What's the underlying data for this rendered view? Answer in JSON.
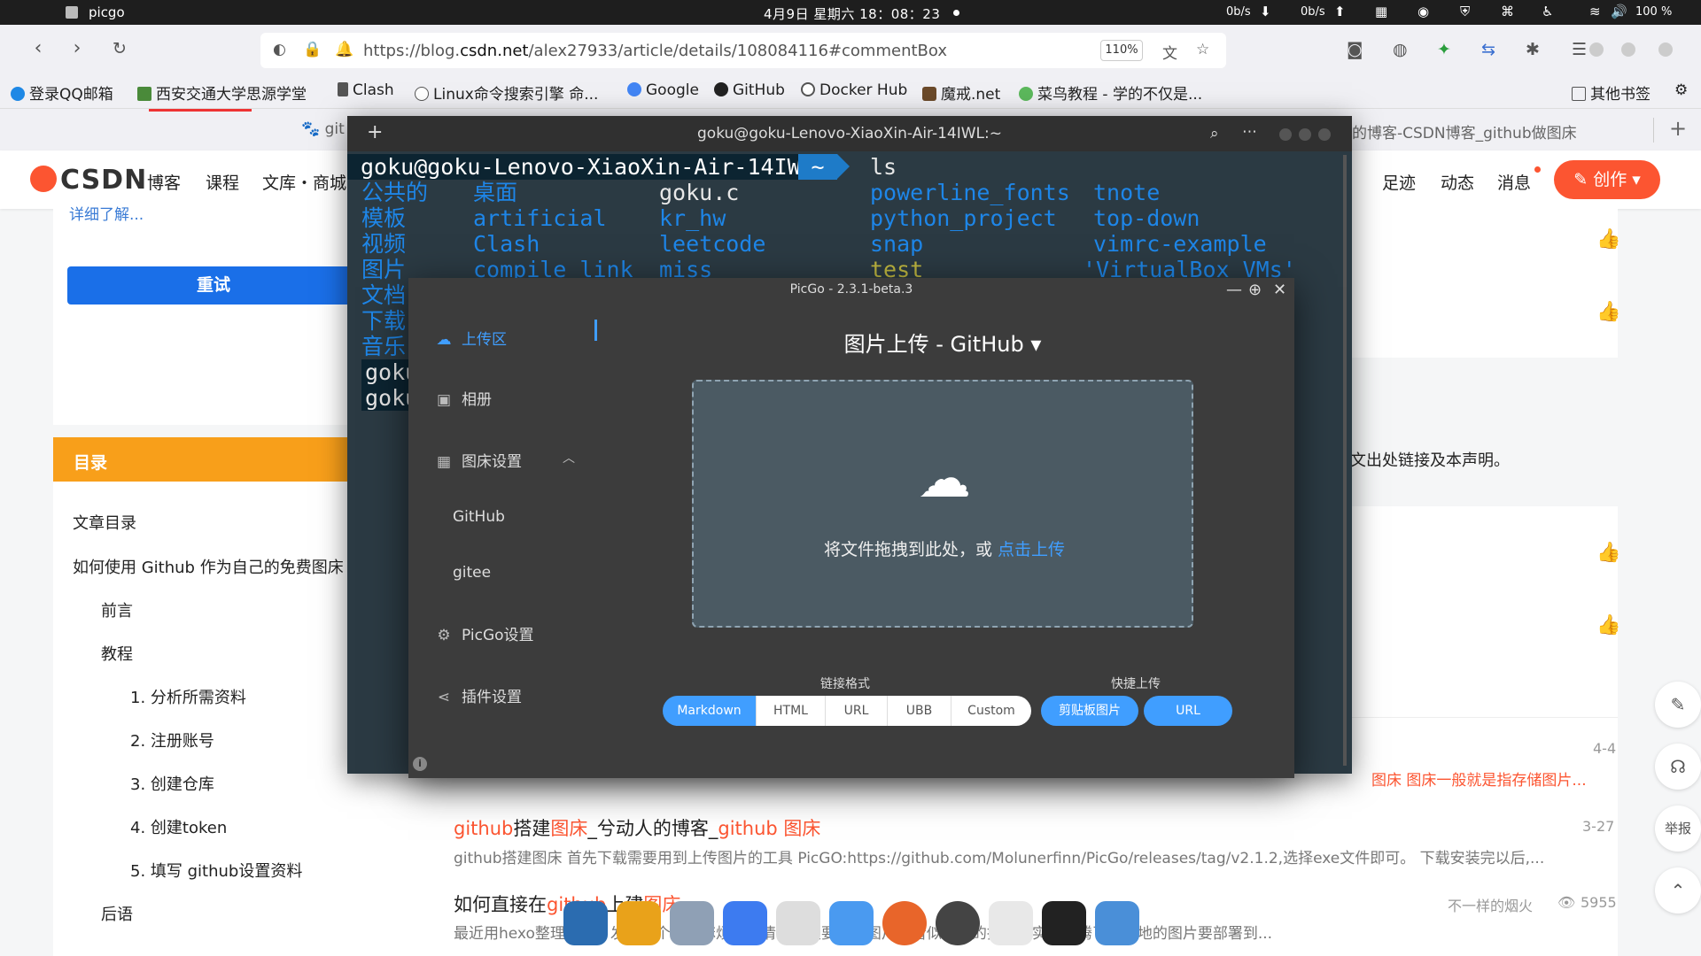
{
  "topbar": {
    "app_name": "picgo",
    "clock": "4月9日 星期六 18：08：23",
    "net_down": "0b/s",
    "net_up": "0b/s",
    "battery": "100 %"
  },
  "browser": {
    "url_prefix": "https://blog.",
    "url_domain": "csdn.net",
    "url_suffix": "/alex27933/article/details/108084116#commentBox",
    "zoom": "110%",
    "bookmarks": [
      "登录QQ邮箱",
      "西安交通大学思源学堂",
      "Clash",
      "Linux命令搜索引擎 命...",
      "Google",
      "GitHub",
      "Docker Hub",
      "魔戒.net",
      "菜鸟教程 - 学的不仅是..."
    ],
    "other_bookmarks": "其他书签",
    "tab_left": "git",
    "tab_right": "的博客-CSDN博客_github做图床"
  },
  "csdn": {
    "logo": "CSDN",
    "nav": [
      "博客",
      "课程",
      "文库・商城"
    ],
    "right_nav": [
      "足迹",
      "动态",
      "消息"
    ],
    "create": "创作",
    "detail_link": "详细了解...",
    "retry": "重试",
    "toc_title": "目录",
    "toc": {
      "heading": "文章目录",
      "title": "如何使用 Github 作为自己的免费图床",
      "items": [
        "前言",
        "教程",
        "1. 分析所需资料",
        "2. 注册账号",
        "3. 创建仓库",
        "4. 创建token",
        "5. 填写 github设置资料",
        "后语"
      ]
    },
    "copyright_fragment": "请附上原文出处链接及本声明。",
    "articles": [
      {
        "title_parts": [
          "github",
          "搭建",
          "图床",
          "_兮动人的博客_",
          "github 图床"
        ],
        "date": "3-27",
        "desc": "github搭建图床 首先下载需要用到上传图片的工具 PicGO:https://github.com/Molunerfinn/PicGo/releases/tag/v2.1.2,选择exe文件即可。 下载安装完以后,..."
      },
      {
        "title_parts": [
          "如何直接在",
          "github",
          "上建",
          "图床"
        ],
        "author": "不一样的烟火",
        "views": "5955",
        "desc": "最近用hexo整理博客，发现一个很是麻烦的事情，就是要插入图片，看似简单的操作其实可折腾了！本地的图片要部署到..."
      }
    ],
    "article0_tail": "图床 图床一般就是指存储图片...",
    "article0_date": "4-4",
    "side_btn": "举报"
  },
  "terminal": {
    "title": "goku@goku-Lenovo-XiaoXin-Air-14IWL:~",
    "prompt": "goku@goku-Lenovo-XiaoXin-Air-14IWL",
    "path": "~",
    "command": "ls",
    "cols": [
      [
        "公共的",
        "模板",
        "视频",
        "图片",
        "文档",
        "下载",
        "音乐"
      ],
      [
        "桌面",
        "artificial",
        "Clash",
        "compile_link"
      ],
      [
        "goku.c",
        "kr_hw",
        "leetcode",
        "miss"
      ],
      [
        "powerline_fonts",
        "python_project",
        "snap",
        "test"
      ],
      [
        "tnote",
        "top-down",
        "vimrc-example",
        "'VirtualBox VMs'"
      ]
    ],
    "prompt_stub": "goku"
  },
  "picgo": {
    "title": "PicGo - 2.3.1-beta.3",
    "menu": [
      "上传区",
      "相册",
      "图床设置",
      "GitHub",
      "gitee",
      "PicGo设置",
      "插件设置"
    ],
    "heading": "图片上传 - GitHub",
    "drop_text": "将文件拖拽到此处，或",
    "drop_link": "点击上传",
    "format_label": "链接格式",
    "formats": [
      "Markdown",
      "HTML",
      "URL",
      "UBB",
      "Custom"
    ],
    "quick_label": "快捷上传",
    "quick": [
      "剪贴板图片",
      "URL"
    ]
  },
  "icons": {
    "upload": "cloud-upload-icon",
    "album": "image-icon",
    "settings": "gear-icon",
    "plugin": "share-icon"
  }
}
